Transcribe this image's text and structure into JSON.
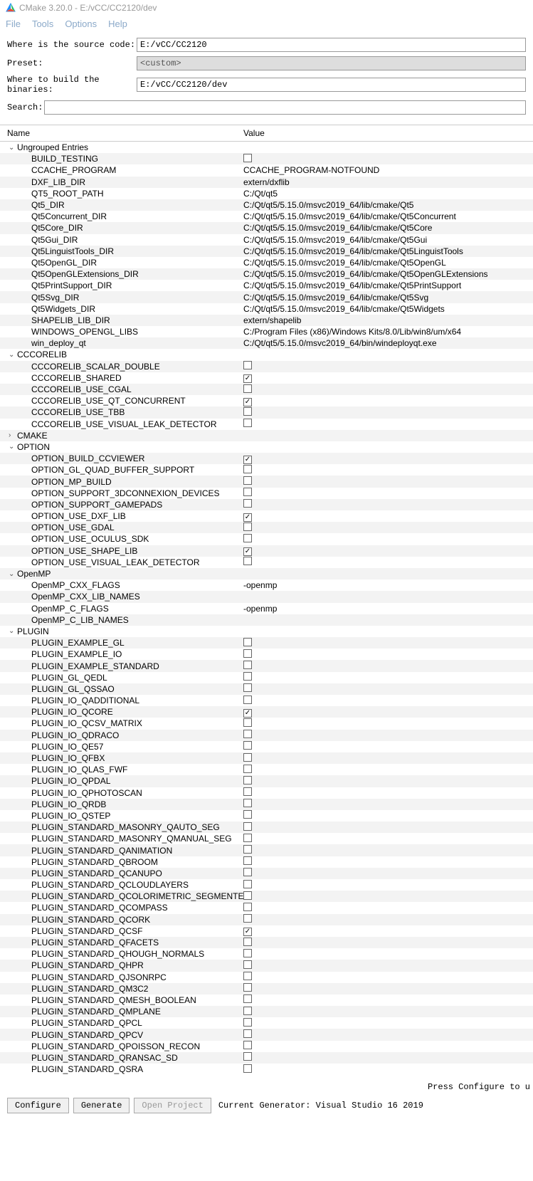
{
  "title": "CMake 3.20.0 - E:/vCC/CC2120/dev",
  "menu": {
    "file": "File",
    "tools": "Tools",
    "options": "Options",
    "help": "Help"
  },
  "form": {
    "source_label": "Where is the source code:",
    "source_value": "E:/vCC/CC2120",
    "preset_label": "Preset:",
    "preset_value": "<custom>",
    "build_label": "Where to build the binaries:",
    "build_value": "E:/vCC/CC2120/dev",
    "search_label": "Search:"
  },
  "columns": {
    "name": "Name",
    "value": "Value"
  },
  "groups": [
    {
      "label": "Ungrouped Entries",
      "expanded": true,
      "entries": [
        {
          "name": "BUILD_TESTING",
          "type": "bool",
          "checked": false
        },
        {
          "name": "CCACHE_PROGRAM",
          "type": "text",
          "value": "CCACHE_PROGRAM-NOTFOUND"
        },
        {
          "name": "DXF_LIB_DIR",
          "type": "text",
          "value": "extern/dxflib"
        },
        {
          "name": "QT5_ROOT_PATH",
          "type": "text",
          "value": "C:/Qt/qt5"
        },
        {
          "name": "Qt5_DIR",
          "type": "text",
          "value": "C:/Qt/qt5/5.15.0/msvc2019_64/lib/cmake/Qt5"
        },
        {
          "name": "Qt5Concurrent_DIR",
          "type": "text",
          "value": "C:/Qt/qt5/5.15.0/msvc2019_64/lib/cmake/Qt5Concurrent"
        },
        {
          "name": "Qt5Core_DIR",
          "type": "text",
          "value": "C:/Qt/qt5/5.15.0/msvc2019_64/lib/cmake/Qt5Core"
        },
        {
          "name": "Qt5Gui_DIR",
          "type": "text",
          "value": "C:/Qt/qt5/5.15.0/msvc2019_64/lib/cmake/Qt5Gui"
        },
        {
          "name": "Qt5LinguistTools_DIR",
          "type": "text",
          "value": "C:/Qt/qt5/5.15.0/msvc2019_64/lib/cmake/Qt5LinguistTools"
        },
        {
          "name": "Qt5OpenGL_DIR",
          "type": "text",
          "value": "C:/Qt/qt5/5.15.0/msvc2019_64/lib/cmake/Qt5OpenGL"
        },
        {
          "name": "Qt5OpenGLExtensions_DIR",
          "type": "text",
          "value": "C:/Qt/qt5/5.15.0/msvc2019_64/lib/cmake/Qt5OpenGLExtensions"
        },
        {
          "name": "Qt5PrintSupport_DIR",
          "type": "text",
          "value": "C:/Qt/qt5/5.15.0/msvc2019_64/lib/cmake/Qt5PrintSupport"
        },
        {
          "name": "Qt5Svg_DIR",
          "type": "text",
          "value": "C:/Qt/qt5/5.15.0/msvc2019_64/lib/cmake/Qt5Svg"
        },
        {
          "name": "Qt5Widgets_DIR",
          "type": "text",
          "value": "C:/Qt/qt5/5.15.0/msvc2019_64/lib/cmake/Qt5Widgets"
        },
        {
          "name": "SHAPELIB_LIB_DIR",
          "type": "text",
          "value": "extern/shapelib"
        },
        {
          "name": "WINDOWS_OPENGL_LIBS",
          "type": "text",
          "value": "C:/Program Files (x86)/Windows Kits/8.0/Lib/win8/um/x64"
        },
        {
          "name": "win_deploy_qt",
          "type": "text",
          "value": "C:/Qt/qt5/5.15.0/msvc2019_64/bin/windeployqt.exe"
        }
      ]
    },
    {
      "label": "CCCORELIB",
      "expanded": true,
      "entries": [
        {
          "name": "CCCORELIB_SCALAR_DOUBLE",
          "type": "bool",
          "checked": false
        },
        {
          "name": "CCCORELIB_SHARED",
          "type": "bool",
          "checked": true
        },
        {
          "name": "CCCORELIB_USE_CGAL",
          "type": "bool",
          "checked": false
        },
        {
          "name": "CCCORELIB_USE_QT_CONCURRENT",
          "type": "bool",
          "checked": true
        },
        {
          "name": "CCCORELIB_USE_TBB",
          "type": "bool",
          "checked": false
        },
        {
          "name": "CCCORELIB_USE_VISUAL_LEAK_DETECTOR",
          "type": "bool",
          "checked": false
        }
      ]
    },
    {
      "label": "CMAKE",
      "expanded": false,
      "entries": []
    },
    {
      "label": "OPTION",
      "expanded": true,
      "entries": [
        {
          "name": "OPTION_BUILD_CCVIEWER",
          "type": "bool",
          "checked": true
        },
        {
          "name": "OPTION_GL_QUAD_BUFFER_SUPPORT",
          "type": "bool",
          "checked": false
        },
        {
          "name": "OPTION_MP_BUILD",
          "type": "bool",
          "checked": false
        },
        {
          "name": "OPTION_SUPPORT_3DCONNEXION_DEVICES",
          "type": "bool",
          "checked": false
        },
        {
          "name": "OPTION_SUPPORT_GAMEPADS",
          "type": "bool",
          "checked": false
        },
        {
          "name": "OPTION_USE_DXF_LIB",
          "type": "bool",
          "checked": true
        },
        {
          "name": "OPTION_USE_GDAL",
          "type": "bool",
          "checked": false
        },
        {
          "name": "OPTION_USE_OCULUS_SDK",
          "type": "bool",
          "checked": false
        },
        {
          "name": "OPTION_USE_SHAPE_LIB",
          "type": "bool",
          "checked": true
        },
        {
          "name": "OPTION_USE_VISUAL_LEAK_DETECTOR",
          "type": "bool",
          "checked": false
        }
      ]
    },
    {
      "label": "OpenMP",
      "expanded": true,
      "entries": [
        {
          "name": "OpenMP_CXX_FLAGS",
          "type": "text",
          "value": "-openmp"
        },
        {
          "name": "OpenMP_CXX_LIB_NAMES",
          "type": "text",
          "value": ""
        },
        {
          "name": "OpenMP_C_FLAGS",
          "type": "text",
          "value": "-openmp"
        },
        {
          "name": "OpenMP_C_LIB_NAMES",
          "type": "text",
          "value": ""
        }
      ]
    },
    {
      "label": "PLUGIN",
      "expanded": true,
      "entries": [
        {
          "name": "PLUGIN_EXAMPLE_GL",
          "type": "bool",
          "checked": false
        },
        {
          "name": "PLUGIN_EXAMPLE_IO",
          "type": "bool",
          "checked": false
        },
        {
          "name": "PLUGIN_EXAMPLE_STANDARD",
          "type": "bool",
          "checked": false
        },
        {
          "name": "PLUGIN_GL_QEDL",
          "type": "bool",
          "checked": false
        },
        {
          "name": "PLUGIN_GL_QSSAO",
          "type": "bool",
          "checked": false
        },
        {
          "name": "PLUGIN_IO_QADDITIONAL",
          "type": "bool",
          "checked": false
        },
        {
          "name": "PLUGIN_IO_QCORE",
          "type": "bool",
          "checked": true
        },
        {
          "name": "PLUGIN_IO_QCSV_MATRIX",
          "type": "bool",
          "checked": false
        },
        {
          "name": "PLUGIN_IO_QDRACO",
          "type": "bool",
          "checked": false
        },
        {
          "name": "PLUGIN_IO_QE57",
          "type": "bool",
          "checked": false
        },
        {
          "name": "PLUGIN_IO_QFBX",
          "type": "bool",
          "checked": false
        },
        {
          "name": "PLUGIN_IO_QLAS_FWF",
          "type": "bool",
          "checked": false
        },
        {
          "name": "PLUGIN_IO_QPDAL",
          "type": "bool",
          "checked": false
        },
        {
          "name": "PLUGIN_IO_QPHOTOSCAN",
          "type": "bool",
          "checked": false
        },
        {
          "name": "PLUGIN_IO_QRDB",
          "type": "bool",
          "checked": false
        },
        {
          "name": "PLUGIN_IO_QSTEP",
          "type": "bool",
          "checked": false
        },
        {
          "name": "PLUGIN_STANDARD_MASONRY_QAUTO_SEG",
          "type": "bool",
          "checked": false
        },
        {
          "name": "PLUGIN_STANDARD_MASONRY_QMANUAL_SEG",
          "type": "bool",
          "checked": false
        },
        {
          "name": "PLUGIN_STANDARD_QANIMATION",
          "type": "bool",
          "checked": false
        },
        {
          "name": "PLUGIN_STANDARD_QBROOM",
          "type": "bool",
          "checked": false
        },
        {
          "name": "PLUGIN_STANDARD_QCANUPO",
          "type": "bool",
          "checked": false
        },
        {
          "name": "PLUGIN_STANDARD_QCLOUDLAYERS",
          "type": "bool",
          "checked": false
        },
        {
          "name": "PLUGIN_STANDARD_QCOLORIMETRIC_SEGMENTER",
          "type": "bool",
          "checked": false
        },
        {
          "name": "PLUGIN_STANDARD_QCOMPASS",
          "type": "bool",
          "checked": false
        },
        {
          "name": "PLUGIN_STANDARD_QCORK",
          "type": "bool",
          "checked": false
        },
        {
          "name": "PLUGIN_STANDARD_QCSF",
          "type": "bool",
          "checked": true
        },
        {
          "name": "PLUGIN_STANDARD_QFACETS",
          "type": "bool",
          "checked": false
        },
        {
          "name": "PLUGIN_STANDARD_QHOUGH_NORMALS",
          "type": "bool",
          "checked": false
        },
        {
          "name": "PLUGIN_STANDARD_QHPR",
          "type": "bool",
          "checked": false
        },
        {
          "name": "PLUGIN_STANDARD_QJSONRPC",
          "type": "bool",
          "checked": false
        },
        {
          "name": "PLUGIN_STANDARD_QM3C2",
          "type": "bool",
          "checked": false
        },
        {
          "name": "PLUGIN_STANDARD_QMESH_BOOLEAN",
          "type": "bool",
          "checked": false
        },
        {
          "name": "PLUGIN_STANDARD_QMPLANE",
          "type": "bool",
          "checked": false
        },
        {
          "name": "PLUGIN_STANDARD_QPCL",
          "type": "bool",
          "checked": false
        },
        {
          "name": "PLUGIN_STANDARD_QPCV",
          "type": "bool",
          "checked": false
        },
        {
          "name": "PLUGIN_STANDARD_QPOISSON_RECON",
          "type": "bool",
          "checked": false
        },
        {
          "name": "PLUGIN_STANDARD_QRANSAC_SD",
          "type": "bool",
          "checked": false
        },
        {
          "name": "PLUGIN_STANDARD_QSRA",
          "type": "bool",
          "checked": false
        }
      ]
    }
  ],
  "status_hint": "Press Configure to u",
  "buttons": {
    "configure": "Configure",
    "generate": "Generate",
    "open_project": "Open Project",
    "generator_label": "Current Generator: Visual Studio 16 2019"
  }
}
